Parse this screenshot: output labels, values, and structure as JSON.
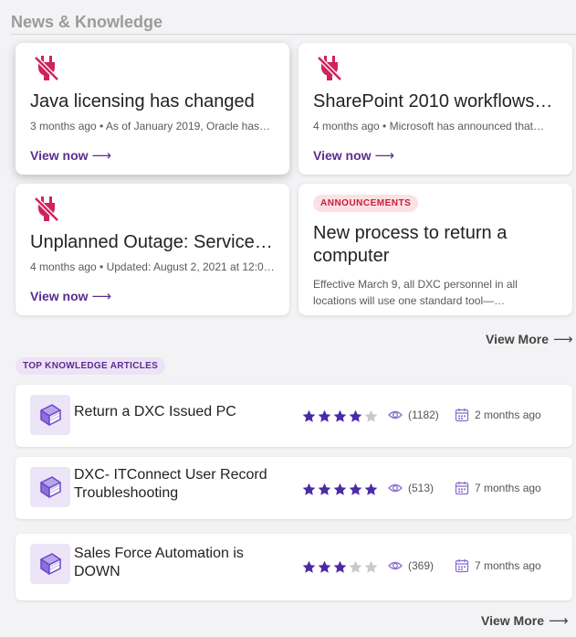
{
  "news": {
    "section_title": "News & Knowledge",
    "cards": [
      {
        "title": "Java licensing has changed",
        "meta": "3 months ago • As of January 2019, Oracle has…",
        "link": "View now"
      },
      {
        "title": "SharePoint 2010 workflows…",
        "meta": "4 months ago • Microsoft has announced that…",
        "link": "View now"
      },
      {
        "title": "Unplanned Outage: Service…",
        "meta": "4 months ago • Updated: August 2, 2021 at 12:0…",
        "link": "View now"
      },
      {
        "badge": "ANNOUNCEMENTS",
        "title": "New process to return a computer",
        "description": "Effective March 9, all DXC personnel in all locations will use one standard tool—…"
      }
    ],
    "view_more": "View More"
  },
  "knowledge": {
    "badge": "TOP KNOWLEDGE ARTICLES",
    "articles": [
      {
        "title": "Return a DXC Issued PC",
        "rating": 4,
        "views": "(1182)",
        "date": "2 months ago"
      },
      {
        "title": "DXC- ITConnect User Record Troubleshooting",
        "rating": 5,
        "views": "(513)",
        "date": "7 months ago"
      },
      {
        "title": "Sales Force Automation is DOWN",
        "rating": 3,
        "views": "(369)",
        "date": "7 months ago"
      }
    ],
    "view_more": "View More"
  },
  "icons": {
    "news": "unplugged-icon",
    "article": "book-icon",
    "star": "star-icon",
    "views": "eye-icon",
    "date": "calendar-icon",
    "arrow": "arrow-right-icon"
  },
  "colors": {
    "accent": "#5b2d8e",
    "star_filled": "#4b2aa8",
    "star_empty": "#c9c9c9",
    "news_icon": "#d0235b",
    "announcement_badge_bg": "#fde0e4",
    "announcement_badge_text": "#c6203b"
  }
}
